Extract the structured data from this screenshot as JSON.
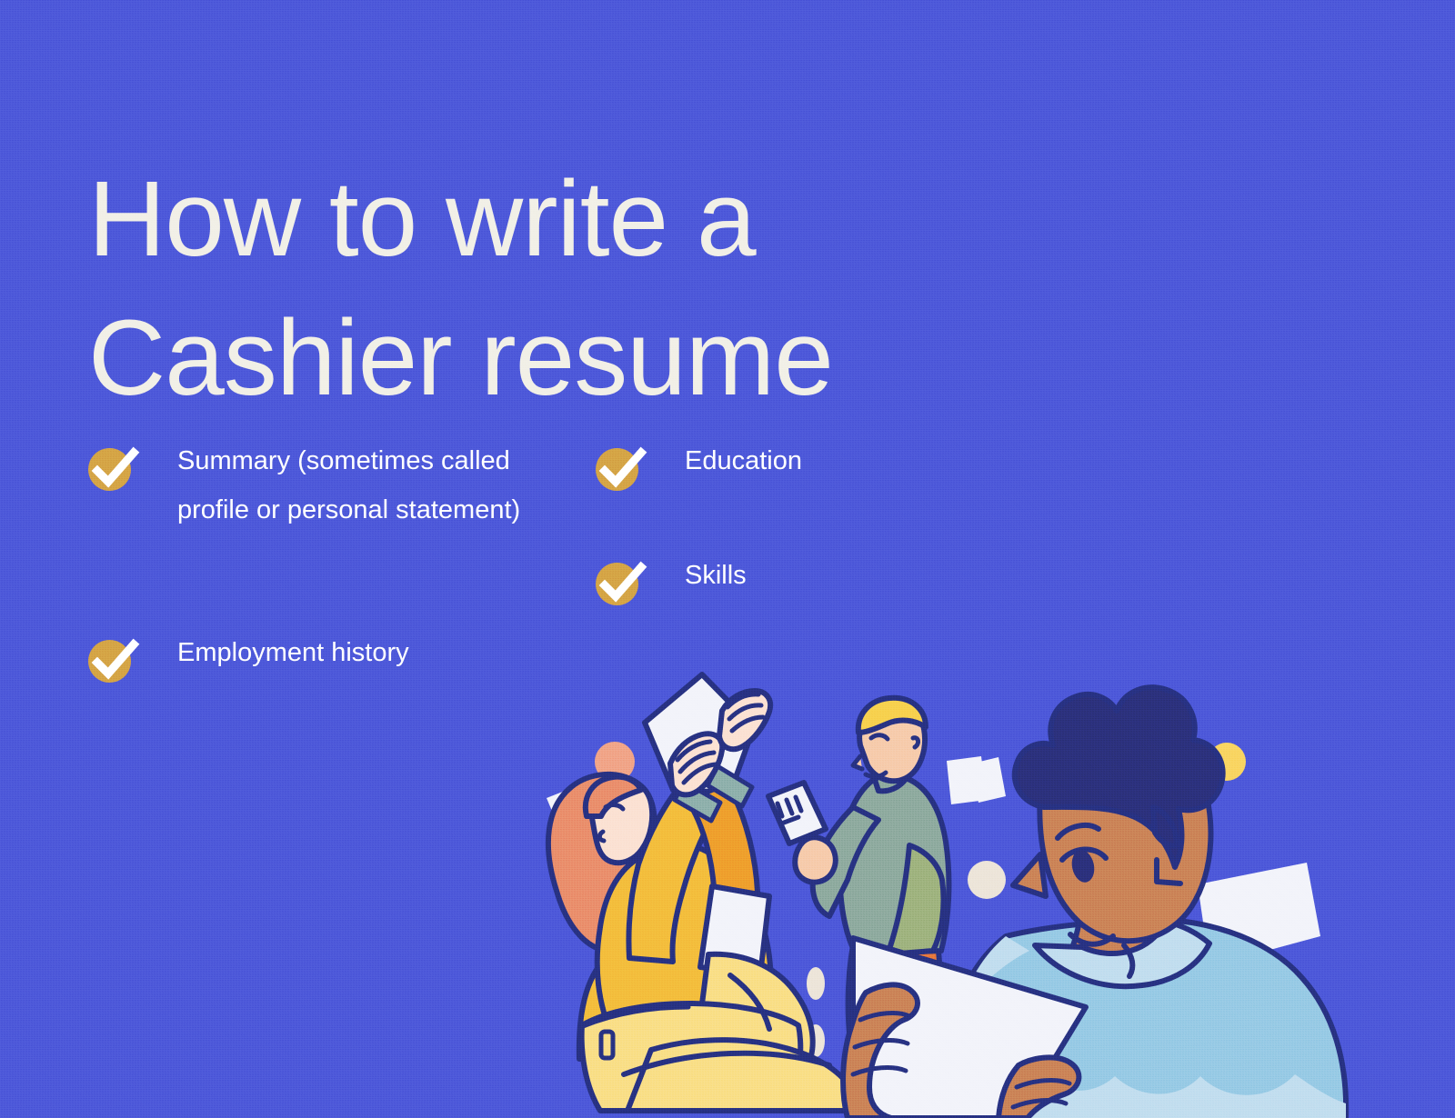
{
  "page": {
    "background_color": "#4a55d8",
    "headline_color": "#f1efe6",
    "accent_color": "#d3a143",
    "text_color": "#ffffff"
  },
  "headline": {
    "line1": "How to write a",
    "line2": "Cashier resume",
    "full": "How to write a\nCashier resume"
  },
  "checklist": {
    "left_column": [
      {
        "icon": "check-circle-icon",
        "label": "Summary (sometimes called profile or personal statement)"
      },
      {
        "icon": "check-circle-icon",
        "label": "Employment history"
      }
    ],
    "right_column": [
      {
        "icon": "check-circle-icon",
        "label": "Education"
      },
      {
        "icon": "check-circle-icon",
        "label": "Skills"
      }
    ]
  },
  "illustration": {
    "name": "three-people-reviewing-resumes-illustration",
    "alt": "Flat illustration of three people reviewing resume documents",
    "colors": {
      "outline": "#26307e",
      "paper": "#f2f3fa",
      "paper_shadow": "#e4e6f2",
      "hair_red": "#e98a68",
      "sweater_yellow": "#f3bb3a",
      "sweater_yellow_dark": "#ee9c2b",
      "pants_yellow": "#f9dd82",
      "cuff_teal": "#8aada8",
      "skin_light": "#fbe0d1",
      "skin_tan": "#f6c9a8",
      "skin_brown": "#c97f54",
      "hair_blond": "#f7cf4b",
      "sweater_sage": "#8aa79b",
      "sweater_sage_dark": "#9bb07a",
      "hair_navy": "#2a2f78",
      "shirt_blue": "#93c8e4",
      "shirt_blue_light": "#bfdcee",
      "pants_brown": "#b07347",
      "dot_peach": "#f0a183",
      "dot_yellow": "#f9d35e",
      "dot_cream": "#ece4d8",
      "orange_accent": "#e8743a"
    },
    "decorative_dots": [
      {
        "name": "peach-dot",
        "color": "#f0a183"
      },
      {
        "name": "yellow-dot",
        "color": "#f9d35e"
      },
      {
        "name": "cream-dot",
        "color": "#ece4d8"
      },
      {
        "name": "cream-dash-dots",
        "color": "#ece4d8",
        "count": 3
      }
    ]
  }
}
